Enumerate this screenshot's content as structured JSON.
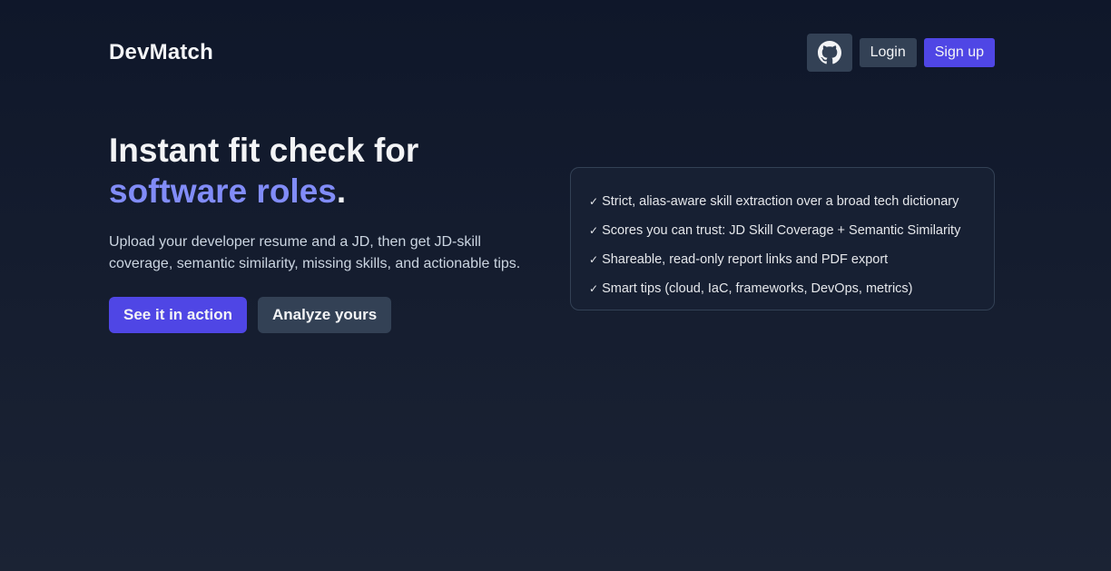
{
  "header": {
    "logo": "DevMatch",
    "github_icon": "github-icon",
    "login_label": "Login",
    "signup_label": "Sign up"
  },
  "hero": {
    "headline_line1": "Instant fit check for",
    "headline_accent": "software roles",
    "headline_period": ".",
    "subtitle": "Upload your developer resume and a JD, then get JD-skill coverage, semantic similarity, missing skills, and actionable tips.",
    "primary_cta": "See it in action",
    "secondary_cta": "Analyze yours"
  },
  "features": [
    "Strict, alias-aware skill extraction over a broad tech dictionary",
    "Scores you can trust: JD Skill Coverage + Semantic Similarity",
    "Shareable, read-only report links and PDF export",
    "Smart tips (cloud, IaC, frameworks, DevOps, metrics)"
  ],
  "check_glyph": "✓",
  "colors": {
    "accent": "#818cf8",
    "primary": "#4f46e5",
    "secondary": "#334155",
    "background": "#0f172a"
  }
}
